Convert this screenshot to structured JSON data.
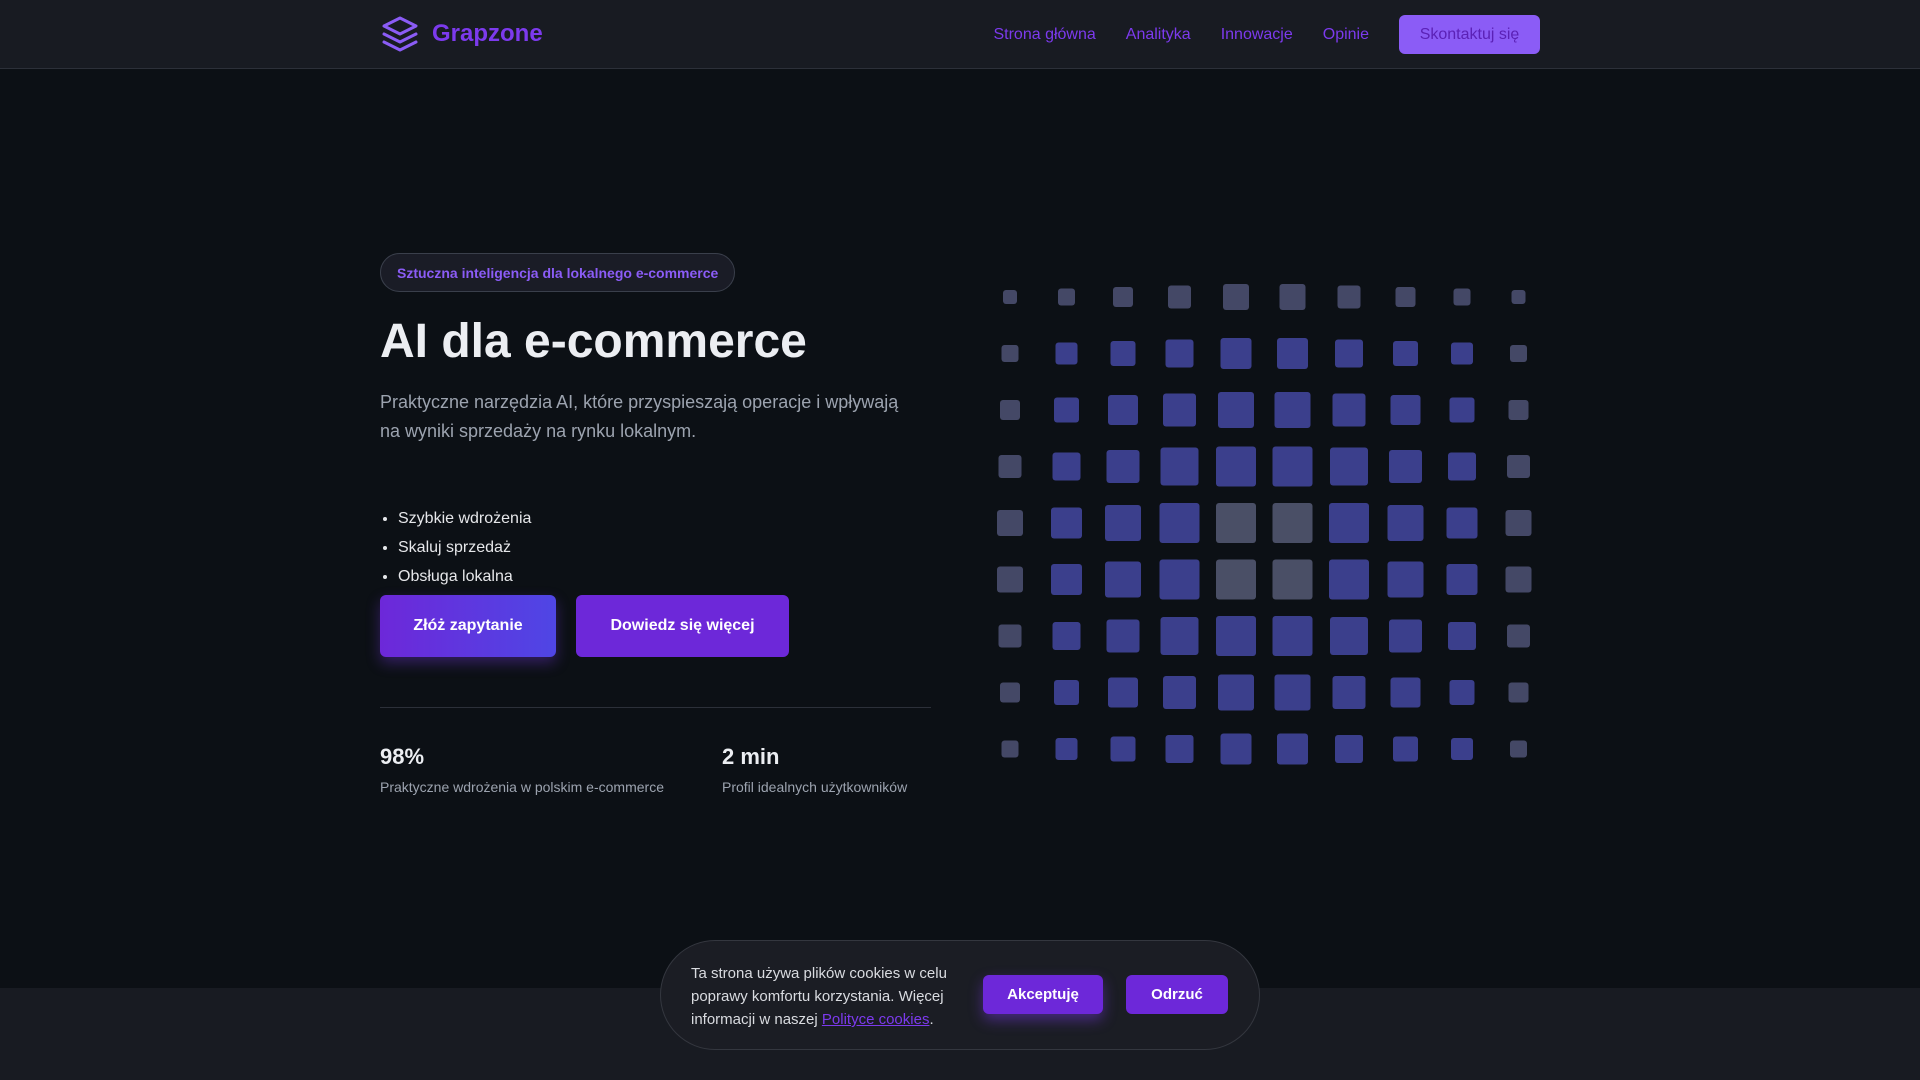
{
  "brand": {
    "name": "Grapzone",
    "logo_icon": "layers-stack-icon"
  },
  "nav": {
    "links": [
      "Strona główna",
      "Analityka",
      "Innowacje",
      "Opinie"
    ],
    "cta": "Skontaktuj się"
  },
  "hero": {
    "badge": "Sztuczna inteligencja dla lokalnego e-commerce",
    "title": "AI dla e-commerce",
    "lede": "Praktyczne narzędzia AI, które przyspieszają operacje i wpływają na wyniki sprzedaży na rynku lokalnym.",
    "bullets": [
      "Szybkie wdrożenia",
      "Skaluj sprzedaż",
      "Obsługa lokalna"
    ],
    "primary_button": "Złóż zapytanie",
    "secondary_button": "Dowiedz się więcej",
    "stats": [
      {
        "value": "98%",
        "label": "Praktyczne wdrożenia w polskim e-commerce"
      },
      {
        "value": "2 min",
        "label": "Profil idealnych użytkowników"
      }
    ]
  },
  "cookie": {
    "text": "Ta strona używa plików cookies w celu poprawy komfortu korzystania. Więcej informacji w naszej",
    "link": "Polityce cookies",
    "suffix": ".",
    "accept": "Akceptuję",
    "reject": "Odrzuć"
  },
  "colors": {
    "accent": "#7c3aed",
    "background": "#0c1015",
    "tile": "#3b3f8c",
    "tile_muted": "#4a4f66"
  }
}
